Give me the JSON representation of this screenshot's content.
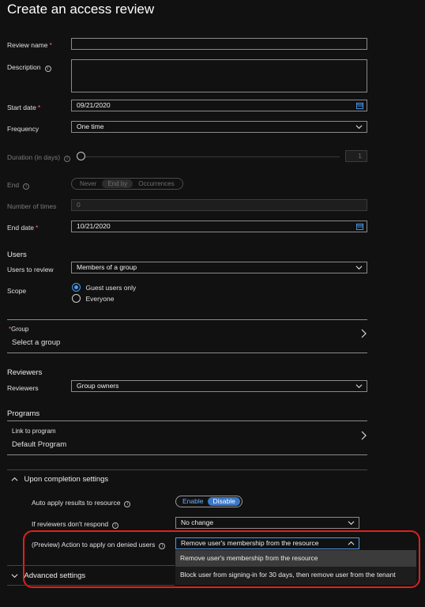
{
  "page": {
    "title": "Create an access review"
  },
  "form": {
    "review_name": {
      "label": "Review name",
      "required": "*",
      "value": ""
    },
    "description": {
      "label": "Description",
      "value": ""
    },
    "start_date": {
      "label": "Start date",
      "required": "*",
      "value": "09/21/2020"
    },
    "frequency": {
      "label": "Frequency",
      "value": "One time"
    },
    "duration": {
      "label": "Duration (in days)",
      "value": "1",
      "disabled": true
    },
    "end": {
      "label": "End",
      "options": [
        "Never",
        "End by",
        "Occurrences"
      ],
      "selected": "End by",
      "disabled": true
    },
    "number_of_times": {
      "label": "Number of times",
      "value": "0",
      "disabled": true
    },
    "end_date": {
      "label": "End date",
      "required": "*",
      "value": "10/21/2020"
    }
  },
  "users": {
    "heading": "Users",
    "users_to_review": {
      "label": "Users to review",
      "value": "Members of a group"
    },
    "scope": {
      "label": "Scope",
      "options": [
        "Guest users only",
        "Everyone"
      ],
      "selected": "Guest users only"
    },
    "group": {
      "required": "*",
      "label": "Group",
      "value": "Select a group"
    }
  },
  "reviewers": {
    "heading": "Reviewers",
    "reviewers": {
      "label": "Reviewers",
      "value": "Group owners"
    }
  },
  "programs": {
    "heading": "Programs",
    "link": {
      "label": "Link to program",
      "value": "Default Program"
    }
  },
  "completion": {
    "heading": "Upon completion settings",
    "auto_apply": {
      "label": "Auto apply results to resource",
      "options": [
        "Enable",
        "Disable"
      ],
      "selected": "Disable"
    },
    "no_response": {
      "label": "If reviewers don't respond",
      "value": "No change"
    },
    "denied_action": {
      "label": "(Preview) Action to apply on denied users",
      "value": "Remove user's membership from the resource",
      "options": [
        "Remove user's membership from the resource",
        "Block user from signing-in for 30 days, then remove user from the tenant"
      ]
    }
  },
  "advanced": {
    "heading": "Advanced settings"
  },
  "colors": {
    "accent": "#4a9cf2",
    "highlight": "#e0201e",
    "background": "#111111"
  }
}
